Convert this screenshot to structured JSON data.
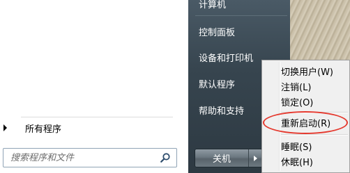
{
  "left_pane": {
    "all_programs_label": "所有程序",
    "search": {
      "placeholder": "搜索程序和文件"
    }
  },
  "right_pane": {
    "items": [
      {
        "label": "计算机"
      },
      {
        "label": "控制面板"
      },
      {
        "label": "设备和打印机"
      },
      {
        "label": "默认程序"
      },
      {
        "label": "帮助和支持"
      }
    ],
    "shutdown_label": "关机"
  },
  "power_menu": {
    "items": [
      {
        "label": "切换用户(W)"
      },
      {
        "label": "注销(L)"
      },
      {
        "label": "锁定(O)"
      },
      {
        "label": "重新启动(R)",
        "highlighted": true
      },
      {
        "label": "睡眠(S)"
      },
      {
        "label": "休眠(H)"
      }
    ]
  },
  "colors": {
    "highlight_ring": "#e5392e",
    "right_pane_bg": "#37454f"
  }
}
